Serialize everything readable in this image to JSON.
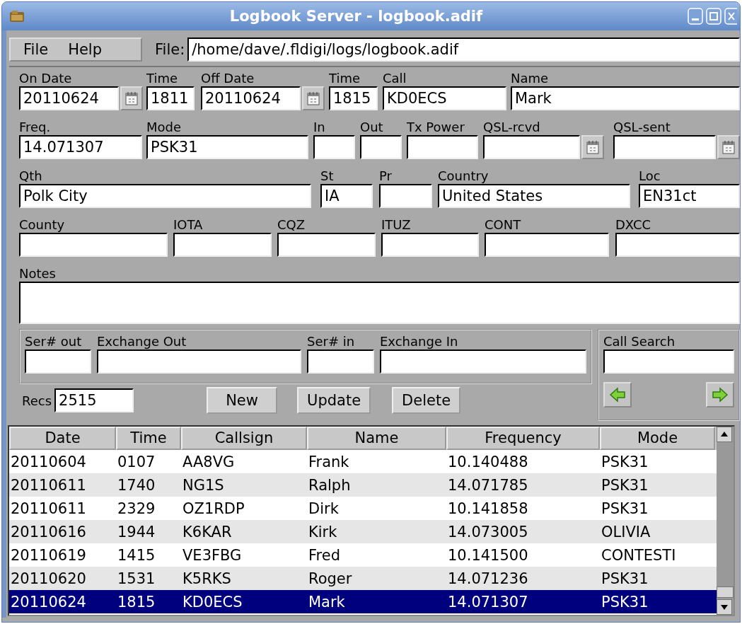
{
  "window": {
    "title": "Logbook Server - logbook.adif"
  },
  "menu": [
    "File",
    "Help"
  ],
  "file": {
    "label": "File:",
    "value": "/home/dave/.fldigi/logs/logbook.adif"
  },
  "form": {
    "lines": [
      {
        "fields": [
          {
            "label": "On Date",
            "value": "20110624",
            "kind": "date"
          },
          {
            "label": "Time",
            "value": "1811",
            "kind": "text"
          },
          {
            "label": "Off Date",
            "value": "20110624",
            "kind": "date"
          },
          {
            "label": "Time",
            "value": "1815",
            "kind": "text"
          },
          {
            "label": "Call",
            "value": "KD0ECS",
            "kind": "text"
          },
          {
            "label": "Name",
            "value": "Mark",
            "kind": "text"
          }
        ]
      },
      {
        "fields": [
          {
            "label": "Freq.",
            "value": "14.071307",
            "kind": "text"
          },
          {
            "label": "Mode",
            "value": "PSK31",
            "kind": "text"
          },
          {
            "label": "In",
            "kind": "text"
          },
          {
            "label": "Out",
            "kind": "text"
          },
          {
            "label": "Tx Power",
            "kind": "text"
          },
          {
            "label": "QSL-rcvd",
            "kind": "date"
          },
          {
            "label": "QSL-sent",
            "kind": "date"
          }
        ]
      },
      {
        "fields": [
          {
            "label": "Qth",
            "value": "Polk City",
            "kind": "text"
          },
          {
            "label": "St",
            "value": "IA",
            "kind": "text"
          },
          {
            "label": "Pr",
            "kind": "text"
          },
          {
            "label": "Country",
            "value": "United States",
            "kind": "text"
          },
          {
            "label": "Loc",
            "value": "EN31ct",
            "kind": "text"
          }
        ]
      },
      {
        "fields": [
          {
            "label": "County",
            "kind": "text"
          },
          {
            "label": "IOTA",
            "kind": "text"
          },
          {
            "label": "CQZ",
            "kind": "text"
          },
          {
            "label": "ITUZ",
            "kind": "text"
          },
          {
            "label": "CONT",
            "kind": "text"
          },
          {
            "label": "DXCC",
            "kind": "text"
          }
        ]
      }
    ],
    "notes": {
      "label": "Notes"
    }
  },
  "contest": [
    {
      "label": "Ser# out"
    },
    {
      "label": "Exchange Out"
    },
    {
      "label": "Ser# in"
    },
    {
      "label": "Exchange In"
    }
  ],
  "records": {
    "label": "Recs",
    "value": "2515"
  },
  "buttons": [
    "New",
    "Update",
    "Delete"
  ],
  "call_search": {
    "label": "Call Search"
  },
  "table": {
    "columns": [
      "Date",
      "Time",
      "Callsign",
      "Name",
      "Frequency",
      "Mode"
    ],
    "rows": [
      {
        "cells": [
          "20110604",
          "0107",
          "AA8VG",
          "Frank",
          "10.140488",
          "PSK31"
        ],
        "selected": false
      },
      {
        "cells": [
          "20110611",
          "1740",
          "NG1S",
          "Ralph",
          "14.071785",
          "PSK31"
        ],
        "selected": false
      },
      {
        "cells": [
          "20110611",
          "2329",
          "OZ1RDP",
          "Dirk",
          "10.141858",
          "PSK31"
        ],
        "selected": false
      },
      {
        "cells": [
          "20110616",
          "1944",
          "K6KAR",
          "Kirk",
          "14.073005",
          "OLIVIA"
        ],
        "selected": false
      },
      {
        "cells": [
          "20110619",
          "1415",
          "VE3FBG",
          "Fred",
          "10.141500",
          "CONTESTI"
        ],
        "selected": false
      },
      {
        "cells": [
          "20110620",
          "1531",
          "K5RKS",
          "Roger",
          "14.071236",
          "PSK31"
        ],
        "selected": false
      },
      {
        "cells": [
          "20110624",
          "1815",
          "KD0ECS",
          "Mark",
          "14.071307",
          "PSK31"
        ],
        "selected": true
      }
    ]
  }
}
